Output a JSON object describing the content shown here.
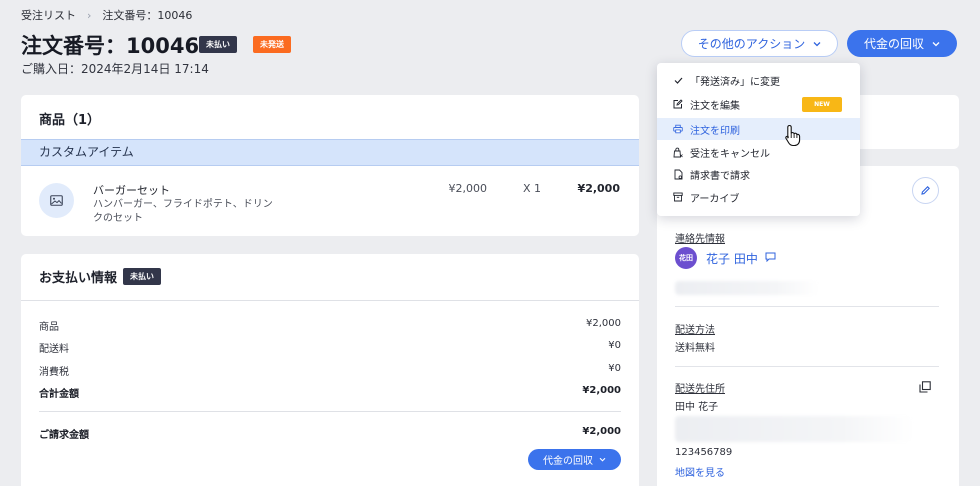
{
  "breadcrumb": {
    "parent": "受注リスト",
    "separator": "›",
    "current": "注文番号：10046"
  },
  "order": {
    "title": "注文番号：10046",
    "payment_badge": "未払い",
    "shipping_badge": "未発送",
    "purchase_date": "ご購入日：2024年2月14日 17:14"
  },
  "actions": {
    "more_label": "その他のアクション",
    "collect_label": "代金の回収"
  },
  "dropdown": {
    "items": [
      {
        "label": "「発送済み」に変更",
        "icon": "check-icon"
      },
      {
        "label": "注文を編集",
        "icon": "edit-icon",
        "badge": "NEW"
      },
      {
        "label": "注文を印刷",
        "icon": "printer-icon"
      },
      {
        "label": "受注をキャンセル",
        "icon": "cancel-bag-icon"
      },
      {
        "label": "請求書で請求",
        "icon": "invoice-icon"
      },
      {
        "label": "アーカイブ",
        "icon": "archive-icon"
      }
    ]
  },
  "products": {
    "heading": "商品（1）",
    "section_label": "カスタムアイテム",
    "items": [
      {
        "name": "バーガーセット",
        "description": "ハンバーガー、フライドポテト、ドリンクのセット",
        "price": "¥2,000",
        "qty": "X 1",
        "total": "¥2,000"
      }
    ]
  },
  "payment": {
    "heading": "お支払い情報",
    "badge": "未払い",
    "rows": [
      {
        "label": "商品",
        "value": "¥2,000"
      },
      {
        "label": "配送料",
        "value": "¥0"
      },
      {
        "label": "消費税",
        "value": "¥0"
      },
      {
        "label": "合計金額",
        "value": "¥2,000"
      }
    ],
    "billed": {
      "label": "ご請求金額",
      "value": "¥2,000"
    },
    "collect_label": "代金の回収"
  },
  "customer": {
    "contact_label": "連絡先情報",
    "avatar_text": "花田",
    "name": "花子 田中",
    "shipping_method_label": "配送方法",
    "shipping_method": "送料無料",
    "address_label": "配送先住所",
    "address_name": "田中 花子",
    "phone": "123456789",
    "map_link": "地図を見る"
  },
  "colors": {
    "accent": "#3b73ec",
    "badge_dark": "#32364a",
    "badge_orange": "#fb6b20",
    "new_badge": "#f8b716"
  }
}
